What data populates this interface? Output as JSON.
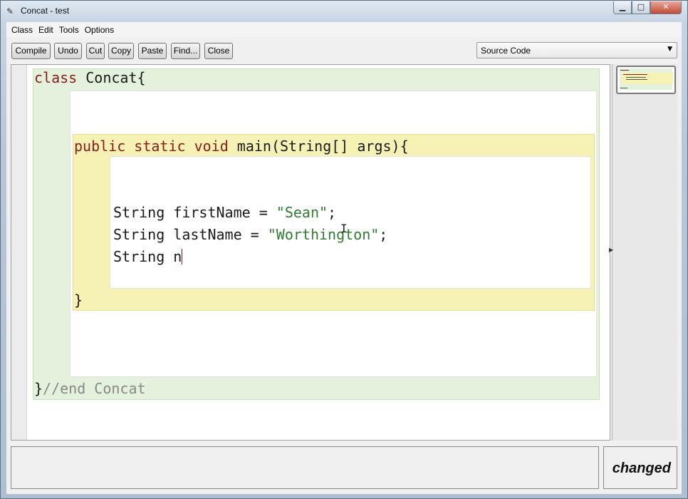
{
  "window": {
    "title": "Concat - test",
    "controls": {
      "minimize": "▁",
      "maximize": "□",
      "close": "✕"
    }
  },
  "menu": [
    "Class",
    "Edit",
    "Tools",
    "Options"
  ],
  "toolbar": {
    "buttons": [
      "Compile",
      "Undo",
      "Cut",
      "Copy",
      "Paste",
      "Find...",
      "Close"
    ],
    "view_select": "Source Code"
  },
  "code": {
    "class_header": {
      "kw": "class",
      "name": " Concat{"
    },
    "method_header": {
      "kw1": "public",
      "kw2": "static",
      "kw3": "void",
      "rest": " main(String[] args){"
    },
    "lines": [
      {
        "pre": "String firstName = ",
        "str": "\"Sean\"",
        "post": ";"
      },
      {
        "pre": "String lastName = ",
        "str": "\"Worthington\"",
        "post": ";"
      },
      {
        "pre": "String n",
        "str": "",
        "post": ""
      }
    ],
    "method_close": "}",
    "class_close": "}",
    "class_close_comment": "//end Concat"
  },
  "status": {
    "message": "",
    "state": "changed"
  },
  "colors": {
    "class_block": "#e4f2dd",
    "method_block": "#f6f2b4",
    "keyword": "#8b1c1c",
    "string": "#2e7d32",
    "comment": "#888888"
  },
  "icons": {
    "app": "bluej-icon",
    "dropdown": "chevron-down-icon",
    "splitter": "triangle-right-icon"
  }
}
